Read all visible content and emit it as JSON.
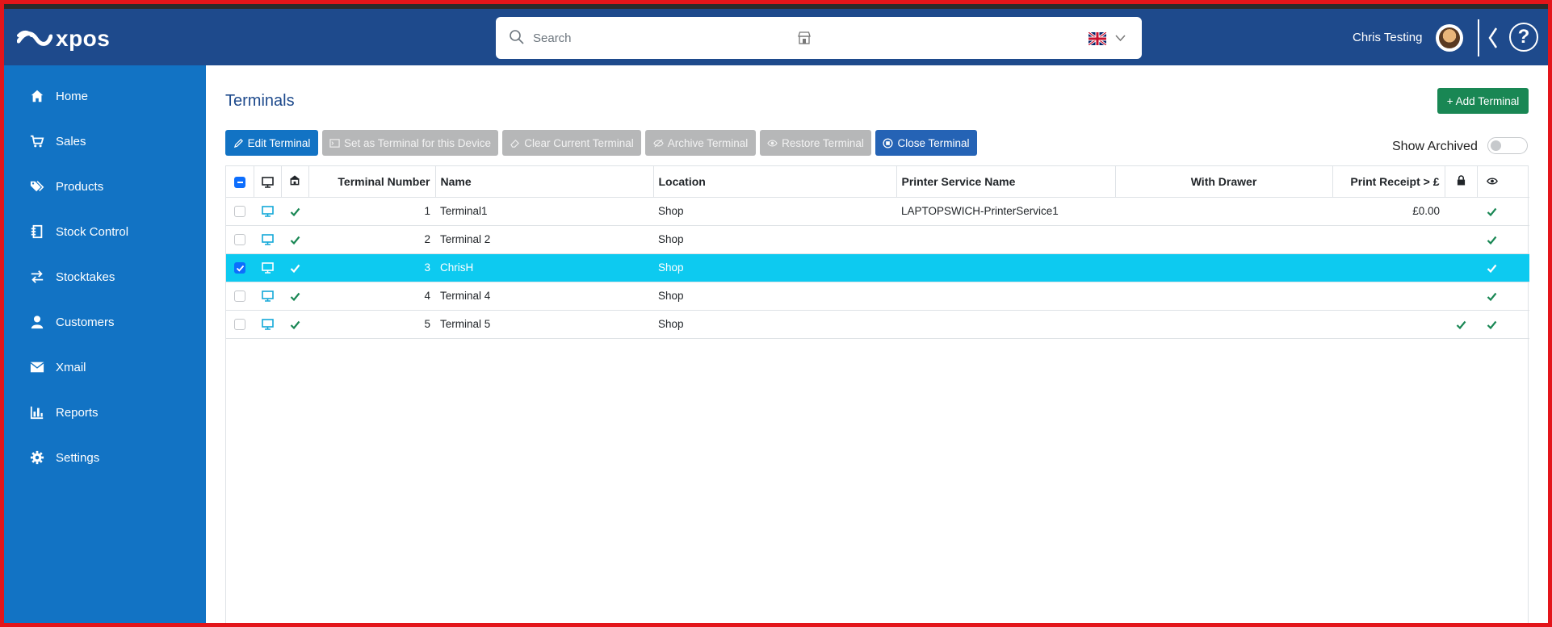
{
  "app": {
    "logo_text": "xpos"
  },
  "search": {
    "placeholder": "Search"
  },
  "header": {
    "user_name": "Chris Testing",
    "help_label": "?"
  },
  "sidebar": {
    "items": [
      {
        "label": "Home",
        "icon": "home-icon"
      },
      {
        "label": "Sales",
        "icon": "cart-icon"
      },
      {
        "label": "Products",
        "icon": "tags-icon"
      },
      {
        "label": "Stock Control",
        "icon": "stock-icon"
      },
      {
        "label": "Stocktakes",
        "icon": "arrows-icon"
      },
      {
        "label": "Customers",
        "icon": "person-icon"
      },
      {
        "label": "Xmail",
        "icon": "mail-icon"
      },
      {
        "label": "Reports",
        "icon": "chart-icon"
      },
      {
        "label": "Settings",
        "icon": "gear-icon"
      }
    ]
  },
  "page": {
    "title": "Terminals",
    "add_button": "+ Add Terminal",
    "show_archived_label": "Show Archived",
    "show_archived": false
  },
  "toolbar": {
    "edit": "Edit Terminal",
    "set_device": "Set as Terminal for this Device",
    "clear_current": "Clear Current Terminal",
    "archive": "Archive Terminal",
    "restore": "Restore Terminal",
    "close": "Close Terminal"
  },
  "table": {
    "headers": {
      "terminal_number": "Terminal Number",
      "name": "Name",
      "location": "Location",
      "printer_service": "Printer Service Name",
      "with_drawer": "With Drawer",
      "print_receipt": "Print Receipt > £"
    },
    "rows": [
      {
        "number": "1",
        "name": "Terminal1",
        "location": "Shop",
        "printer": "LAPTOPSWICH-PrinterService1",
        "drawer": "",
        "receipt": "£0.00",
        "selected": false,
        "locked": false,
        "visible": true
      },
      {
        "number": "2",
        "name": "Terminal 2",
        "location": "Shop",
        "printer": "",
        "drawer": "",
        "receipt": "",
        "selected": false,
        "locked": false,
        "visible": true
      },
      {
        "number": "3",
        "name": "ChrisH",
        "location": "Shop",
        "printer": "",
        "drawer": "",
        "receipt": "",
        "selected": true,
        "locked": false,
        "visible": true
      },
      {
        "number": "4",
        "name": "Terminal 4",
        "location": "Shop",
        "printer": "",
        "drawer": "",
        "receipt": "",
        "selected": false,
        "locked": false,
        "visible": true
      },
      {
        "number": "5",
        "name": "Terminal 5",
        "location": "Shop",
        "printer": "",
        "drawer": "",
        "receipt": "",
        "selected": false,
        "locked": true,
        "visible": true
      }
    ]
  },
  "colors": {
    "header": "#1e4a8c",
    "sidebar": "#1273c4",
    "selected_row": "#0dcaf0",
    "success": "#198754"
  }
}
